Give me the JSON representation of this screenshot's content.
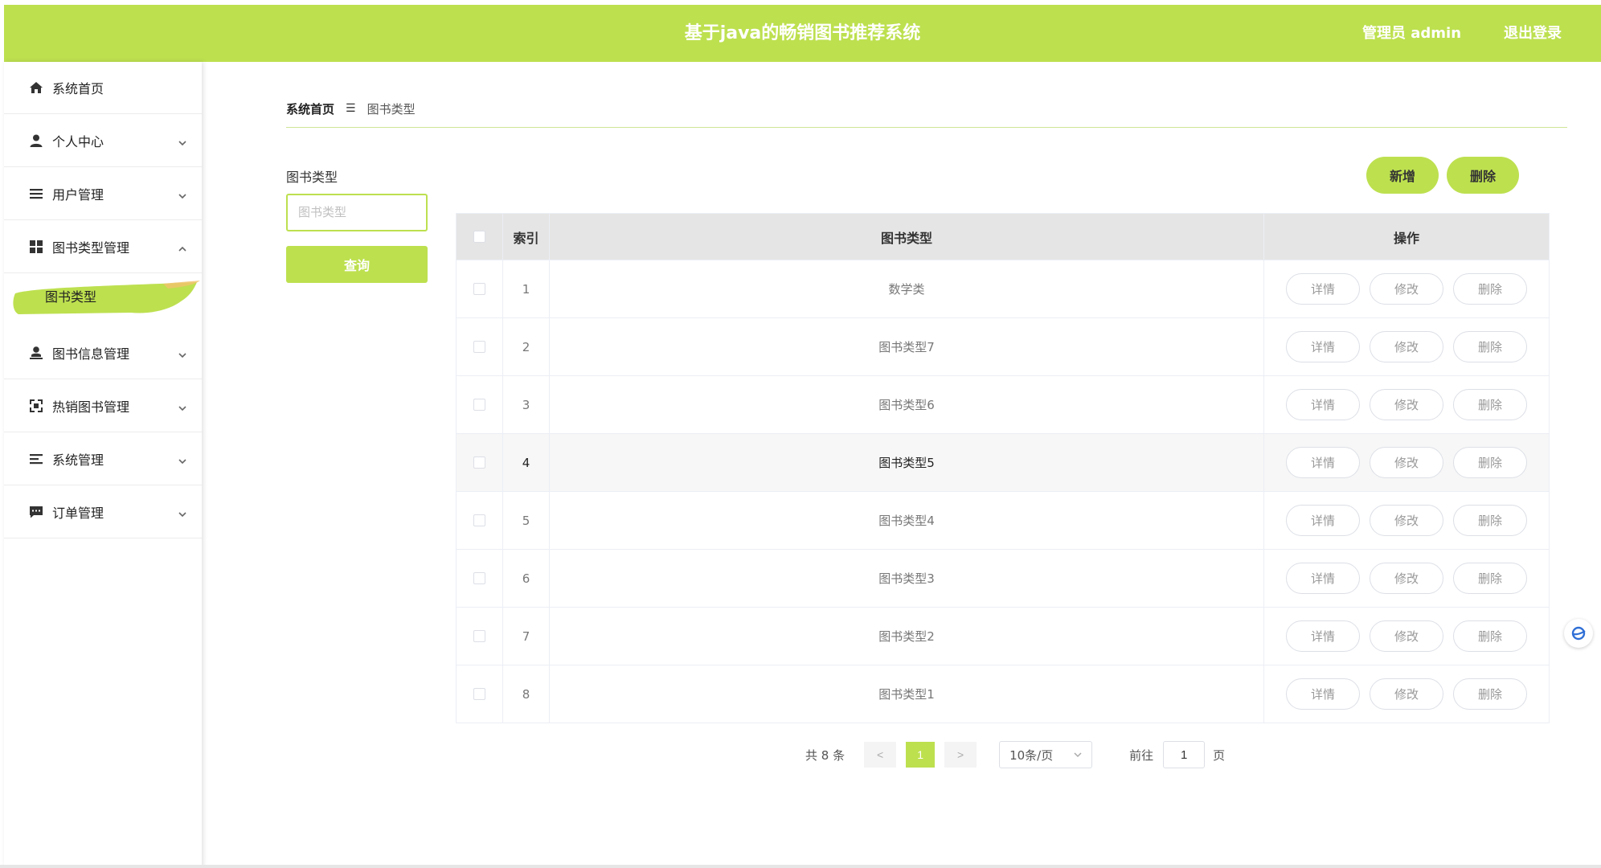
{
  "header": {
    "title": "基于java的畅销图书推荐系统",
    "user": "管理员 admin",
    "logout": "退出登录",
    "accent_color": "#bde04f"
  },
  "sidebar": {
    "items": [
      {
        "label": "系统首页",
        "icon": "home-icon",
        "expandable": false
      },
      {
        "label": "个人中心",
        "icon": "person-icon",
        "expandable": true,
        "expanded": false
      },
      {
        "label": "用户管理",
        "icon": "list-icon",
        "expandable": true,
        "expanded": false
      },
      {
        "label": "图书类型管理",
        "icon": "grid-icon",
        "expandable": true,
        "expanded": true
      },
      {
        "label": "图书信息管理",
        "icon": "user-stamp-icon",
        "expandable": true,
        "expanded": false
      },
      {
        "label": "热销图书管理",
        "icon": "scan-icon",
        "expandable": true,
        "expanded": false
      },
      {
        "label": "系统管理",
        "icon": "lines-icon",
        "expandable": true,
        "expanded": false
      },
      {
        "label": "订单管理",
        "icon": "chat-icon",
        "expandable": true,
        "expanded": false
      }
    ],
    "active_submenu": "图书类型"
  },
  "breadcrumb": {
    "home": "系统首页",
    "current": "图书类型"
  },
  "search": {
    "label": "图书类型",
    "placeholder": "图书类型",
    "value": "",
    "button": "查询"
  },
  "actions": {
    "add": "新增",
    "delete": "删除"
  },
  "table": {
    "headers": {
      "index": "索引",
      "type": "图书类型",
      "ops": "操作"
    },
    "row_actions": {
      "detail": "详情",
      "edit": "修改",
      "delete": "删除"
    },
    "rows": [
      {
        "index": "1",
        "type": "数学类"
      },
      {
        "index": "2",
        "type": "图书类型7"
      },
      {
        "index": "3",
        "type": "图书类型6"
      },
      {
        "index": "4",
        "type": "图书类型5"
      },
      {
        "index": "5",
        "type": "图书类型4"
      },
      {
        "index": "6",
        "type": "图书类型3"
      },
      {
        "index": "7",
        "type": "图书类型2"
      },
      {
        "index": "8",
        "type": "图书类型1"
      }
    ],
    "highlighted_row": 3
  },
  "pagination": {
    "total": "共 8 条",
    "prev": "<",
    "current": "1",
    "next": ">",
    "page_size": "10条/页",
    "goto": "前往",
    "goto_value": "1",
    "page_suffix": "页"
  }
}
